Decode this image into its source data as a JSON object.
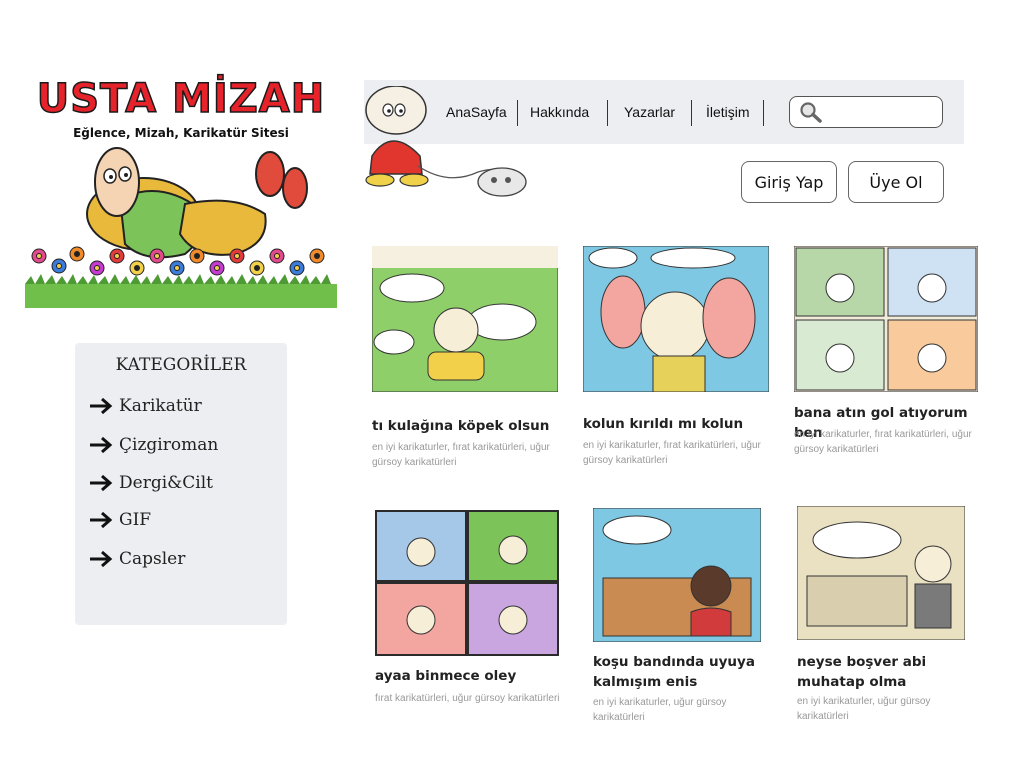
{
  "logo": {
    "title": "USTA MİZAH",
    "subtitle": "Eğlence, Mizah, Karikatür Sitesi"
  },
  "nav": {
    "items": [
      {
        "label": "AnaSayfa"
      },
      {
        "label": "Hakkında"
      },
      {
        "label": "Yazarlar"
      },
      {
        "label": "İletişim"
      }
    ],
    "search_placeholder": ""
  },
  "auth": {
    "login_label": "Giriş Yap",
    "register_label": "Üye Ol"
  },
  "categories": {
    "title": "KATEGORİLER",
    "items": [
      {
        "label": "Karikatür"
      },
      {
        "label": "Çizgiroman"
      },
      {
        "label": "Dergi&Cilt"
      },
      {
        "label": "GIF"
      },
      {
        "label": "Capsler"
      }
    ]
  },
  "cards": [
    {
      "title": "tı kulağına köpek olsun",
      "tags": "en iyi karikaturler, fırat karikatürleri, uğur gürsoy karikatürleri"
    },
    {
      "title": "kolun kırıldı mı kolun",
      "tags": "en iyi karikaturler, fırat karikatürleri, uğur gürsoy karikatürleri"
    },
    {
      "title": "bana atın gol atıyorum ben",
      "tags": "en iyi karikaturler, fırat karikatürleri, uğur gürsoy karikatürleri"
    },
    {
      "title": "ayaa binmece oley",
      "tags": "fırat karikatürleri, uğur gürsoy karikatürleri"
    },
    {
      "title": "koşu bandında uyuya kalmışım enis",
      "tags": "en iyi karikaturler, uğur gürsoy karikatürleri"
    },
    {
      "title": "neyse boşver abi muhatap olma",
      "tags": "en iyi karikaturler, uğur gürsoy karikatürleri"
    }
  ],
  "colors": {
    "logo_red": "#e6232a",
    "panel_bg": "#eceef2"
  }
}
